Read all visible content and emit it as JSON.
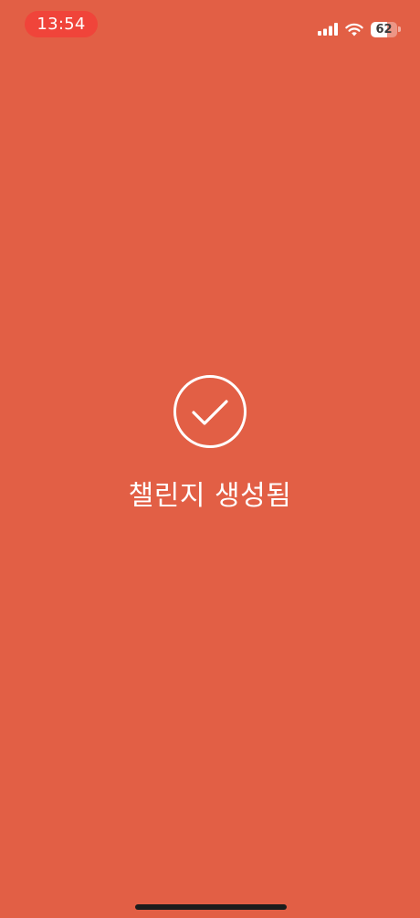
{
  "status_bar": {
    "time": "13:54",
    "battery_level": "62",
    "battery_fraction": 0.62,
    "signal_bars_filled": 4,
    "recording_pill_color": "#F0443A"
  },
  "main": {
    "icon": "check-circle-icon",
    "message": "챌린지 생성됨"
  },
  "colors": {
    "background": "#E25F45",
    "foreground": "#FFFFFF"
  }
}
